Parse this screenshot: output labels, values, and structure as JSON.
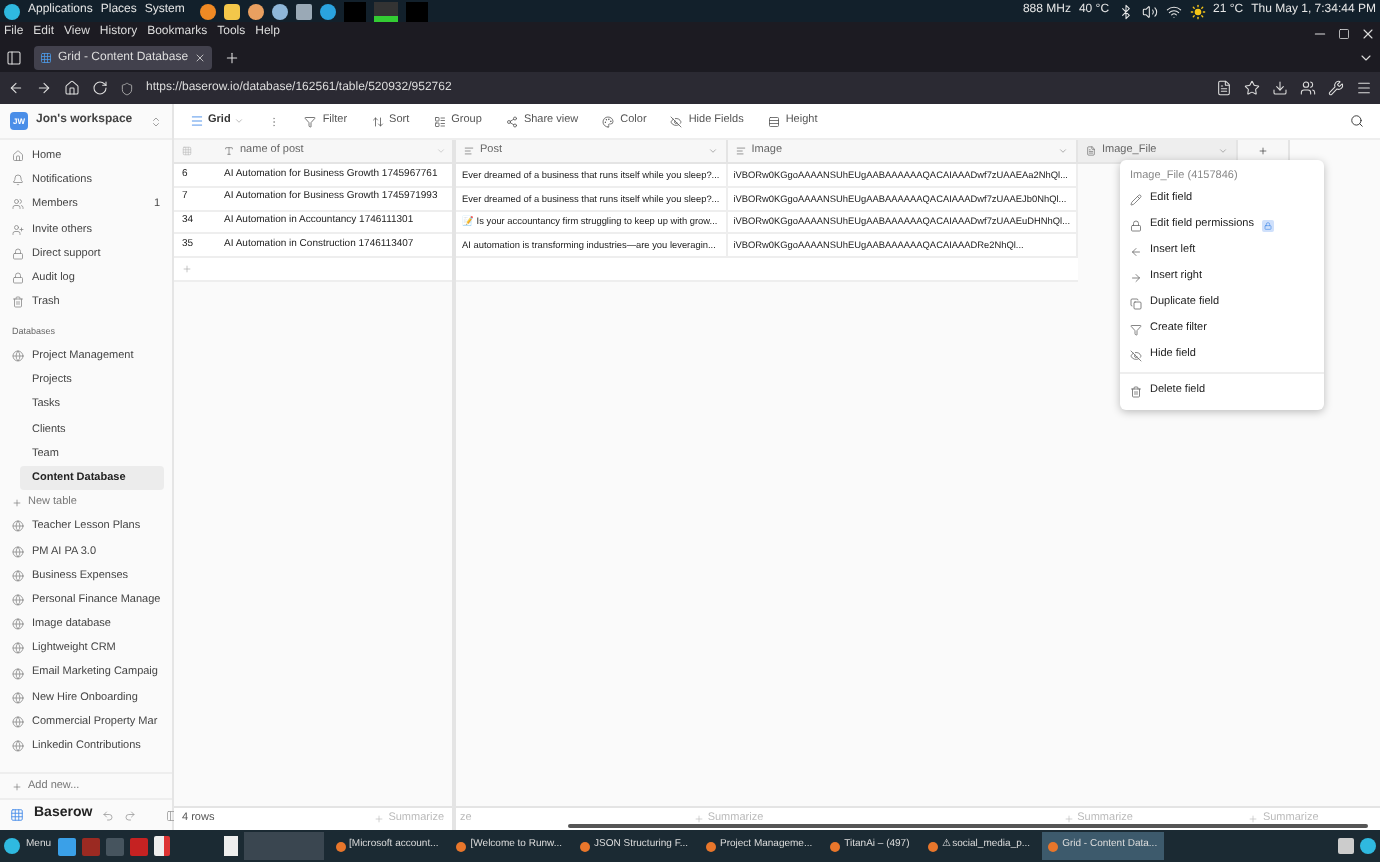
{
  "system_bar": {
    "menus": [
      "Applications",
      "Places",
      "System"
    ],
    "cpu": "888 MHz",
    "temp": "40 °C",
    "weather": "21 °C",
    "clock": "Thu May 1, 7:34:44 PM"
  },
  "browser": {
    "menu": [
      "File",
      "Edit",
      "View",
      "History",
      "Bookmarks",
      "Tools",
      "Help"
    ],
    "tab_title": "Grid - Content Database",
    "url": "https://baserow.io/database/162561/table/520932/952762"
  },
  "workspace": {
    "initials": "JW",
    "name": "Jon's workspace"
  },
  "toolbar": {
    "view": "Grid",
    "items": [
      "Filter",
      "Sort",
      "Group",
      "Share view",
      "Color",
      "Hide Fields",
      "Height"
    ]
  },
  "sidebar": {
    "items": [
      {
        "label": "Home"
      },
      {
        "label": "Notifications"
      },
      {
        "label": "Members",
        "count": "1"
      },
      {
        "label": "Invite others"
      },
      {
        "label": "Direct support"
      },
      {
        "label": "Audit log"
      },
      {
        "label": "Trash"
      }
    ],
    "section": "Databases",
    "database": {
      "name": "Project Management",
      "tables": [
        {
          "label": "Projects",
          "selected": false
        },
        {
          "label": "Tasks",
          "selected": false
        },
        {
          "label": "Clients",
          "selected": false
        },
        {
          "label": "Team",
          "selected": false
        },
        {
          "label": "Content Database",
          "selected": true
        }
      ]
    },
    "new_table": "New table",
    "databases": [
      "Teacher Lesson Plans",
      "PM AI PA 3.0",
      "Business Expenses",
      "Personal Finance Manage",
      "Image database",
      "Lightweight CRM",
      "Email Marketing Campaig",
      "New Hire Onboarding",
      "Commercial Property Mar",
      "Linkedin Contributions"
    ],
    "add_new": "Add new...",
    "brand": "Baserow"
  },
  "table": {
    "columns": [
      "name of post",
      "Post",
      "Image",
      "Image_File"
    ],
    "rows": [
      {
        "id": "6",
        "name": "AI Automation for Business Growth 1745967761",
        "post": "Ever dreamed of a business that runs itself while you sleep?...",
        "image": "iVBORw0KGgoAAAANSUhEUgAABAAAAAAQACAIAAADwf7zUAAEAa2NhQl..."
      },
      {
        "id": "7",
        "name": "AI Automation for Business Growth 1745971993",
        "post": "Ever dreamed of a business that runs itself while you sleep?...",
        "image": "iVBORw0KGgoAAAANSUhEUgAABAAAAAAQACAIAAADwf7zUAAEJb0NhQl..."
      },
      {
        "id": "34",
        "name": "AI Automation in Accountancy 1746111301",
        "post": "📝 Is your accountancy firm struggling to keep up with grow...",
        "image": "iVBORw0KGgoAAAANSUhEUgAABAAAAAAQACAIAAADwf7zUAAEuDHNhQl..."
      },
      {
        "id": "35",
        "name": "AI Automation in Construction 1746113407",
        "post": "AI automation is transforming industries—are you leveragin...",
        "image": "iVBORw0KGgoAAAANSUhEUgAABAAAAAAQACAIAAADRe2NhQl..."
      }
    ],
    "footer": {
      "count": "4 rows",
      "summarize": [
        "Summarize",
        "Summarize",
        "Summarize",
        "Summarize"
      ],
      "cut": "ze"
    }
  },
  "context_menu": {
    "title": "Image_File (4157846)",
    "items": [
      {
        "label": "Edit field",
        "kind": "edit"
      },
      {
        "label": "Edit field permissions",
        "kind": "permissions"
      },
      {
        "label": "Insert left",
        "kind": "left"
      },
      {
        "label": "Insert right",
        "kind": "right"
      },
      {
        "label": "Duplicate field",
        "kind": "duplicate"
      },
      {
        "label": "Create filter",
        "kind": "filter"
      },
      {
        "label": "Hide field",
        "kind": "hide"
      },
      {
        "label": "Delete field",
        "kind": "delete"
      }
    ]
  },
  "taskbar": {
    "menu": "Menu",
    "windows": [
      {
        "label": "[Microsoft account...",
        "selected": false
      },
      {
        "label": "[Welcome to Runw...",
        "selected": false
      },
      {
        "label": "JSON Structuring F...",
        "selected": false
      },
      {
        "label": "Project Manageme...",
        "selected": false
      },
      {
        "label": "TitanAi – (497)",
        "selected": false
      },
      {
        "label": "⚠ social_media_p...",
        "selected": false
      },
      {
        "label": "Grid - Content Data...",
        "selected": true
      }
    ]
  }
}
